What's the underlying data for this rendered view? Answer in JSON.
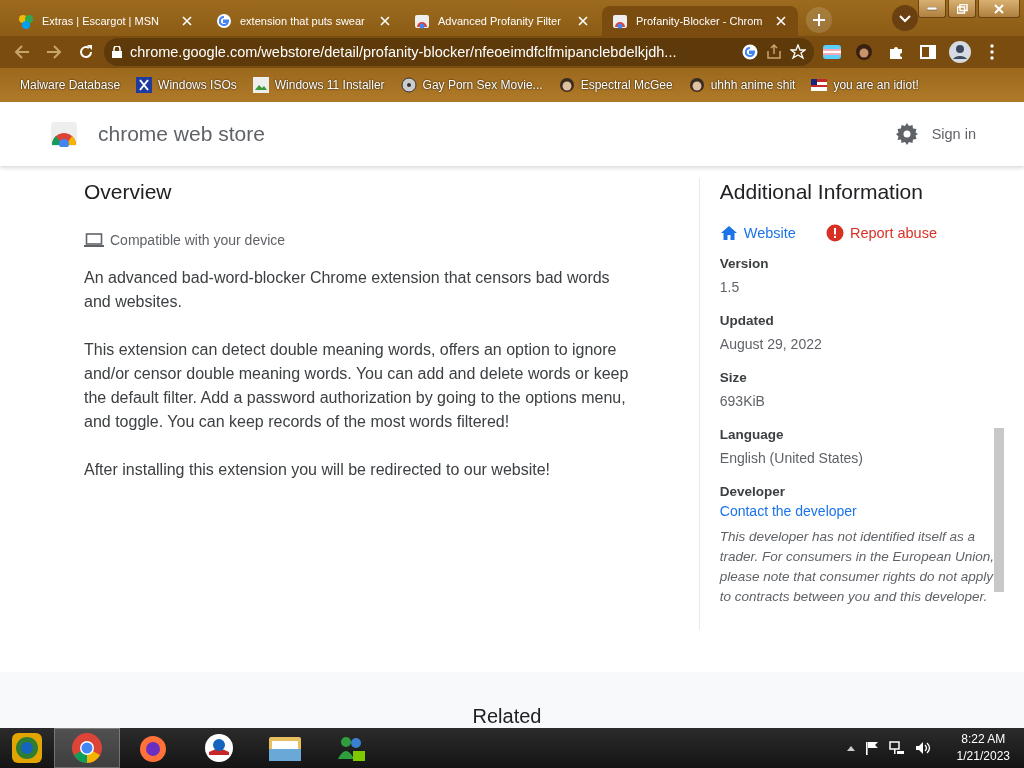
{
  "browser": {
    "tabs": [
      {
        "title": "Extras | Escargot | MSN",
        "kind": "msn",
        "selected": false
      },
      {
        "title": "extension that puts swear",
        "kind": "google",
        "selected": false
      },
      {
        "title": "Advanced Profanity Filter",
        "kind": "store",
        "selected": false
      },
      {
        "title": "Profanity-Blocker - Chrom",
        "kind": "store",
        "selected": true
      }
    ],
    "address": "chrome.google.com/webstore/detail/profanity-blocker/nfeoeimdfclfmipanclebdelkjdh...",
    "bookmarks": [
      {
        "label": "Malware Database",
        "kind": "none"
      },
      {
        "label": "Windows ISOs",
        "kind": "x"
      },
      {
        "label": "Windows 11 Installer",
        "kind": "image"
      },
      {
        "label": "Gay Porn Sex Movie...",
        "kind": "disc"
      },
      {
        "label": "Espectral McGee",
        "kind": "face"
      },
      {
        "label": "uhhh anime shit",
        "kind": "face"
      },
      {
        "label": "you are an idiot!",
        "kind": "flag"
      }
    ]
  },
  "store_header": {
    "title": "chrome web store",
    "sign_in": "Sign in"
  },
  "overview": {
    "heading": "Overview",
    "compatibility": "Compatible with your device",
    "paragraphs": [
      "An advanced bad-word-blocker Chrome extension that censors bad words and websites.",
      "This extension can detect double meaning words, offers an option to ignore and/or censor double meaning words. You can add and delete words or keep the default filter. Add a password authorization by going to the options menu, and toggle. You can keep records of the most words filtered!",
      "After installing this extension you will be redirected to our website!"
    ]
  },
  "additional_info": {
    "heading": "Additional Information",
    "links": [
      {
        "label": "Website",
        "kind": "website"
      },
      {
        "label": "Report abuse",
        "kind": "report"
      }
    ],
    "fields": [
      {
        "label": "Version",
        "value": "1.5"
      },
      {
        "label": "Updated",
        "value": "August 29, 2022"
      },
      {
        "label": "Size",
        "value": "693KiB"
      },
      {
        "label": "Language",
        "value": "English (United States)"
      }
    ],
    "developer": {
      "label": "Developer",
      "link": "Contact the developer",
      "note": "This developer has not identified itself as a trader. For consumers in the European Union, please note that consumer rights do not apply to contracts between you and this developer."
    }
  },
  "footer": {
    "heading": "Related"
  },
  "taskbar": {
    "apps": [
      {
        "kind": "start",
        "selected": false
      },
      {
        "kind": "chrome",
        "selected": true
      },
      {
        "kind": "firefox",
        "selected": false
      },
      {
        "kind": "circle-logo",
        "selected": false
      },
      {
        "kind": "folder",
        "selected": false
      },
      {
        "kind": "messenger",
        "selected": false
      }
    ],
    "time": "8:22 AM",
    "date": "1/21/2023"
  }
}
